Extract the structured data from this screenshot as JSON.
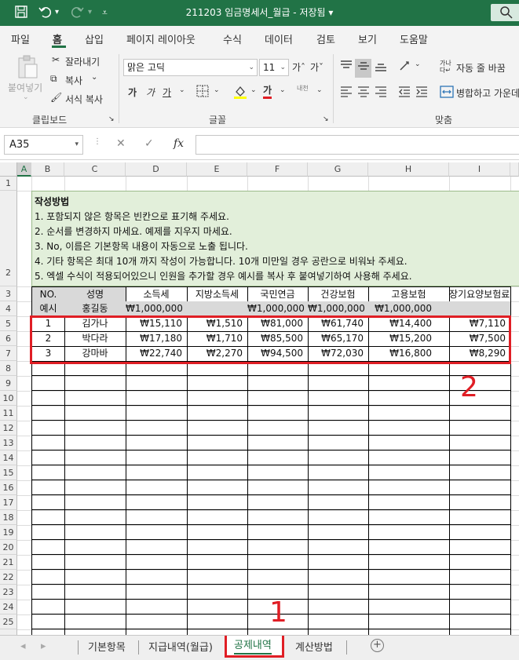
{
  "titlebar": {
    "title": "211203 임금명세서_월급  -  저장됨  ▾",
    "save_icon": "save-icon",
    "undo_icon": "undo-icon",
    "redo_icon": "redo-icon",
    "customize_icon": "customize-qat-icon"
  },
  "ribbon_tabs": [
    "파일",
    "홈",
    "삽입",
    "페이지 레이아웃",
    "수식",
    "데이터",
    "검토",
    "보기",
    "도움말"
  ],
  "clipboard": {
    "paste": "붙여넣기",
    "cut": "잘라내기",
    "copy": "복사",
    "format_painter": "서식 복사",
    "group": "클립보드"
  },
  "font": {
    "name": "맑은 고딕",
    "size": "11",
    "grow": "가ˆ",
    "shrink": "가ˇ",
    "bold": "가",
    "italic": "가",
    "underline": "가",
    "font_color": "가",
    "phonetic": "내천",
    "group": "글꼴"
  },
  "alignment": {
    "wrap_text": "자동 줄 바꿈",
    "merge": "병합하고 가운데",
    "group": "맞춤"
  },
  "formula_bar": {
    "name_box": "A35",
    "fx": "fx",
    "formula": ""
  },
  "columns": [
    "A",
    "B",
    "C",
    "D",
    "E",
    "F",
    "G",
    "H",
    "I"
  ],
  "rows": [
    "1",
    "2",
    "3",
    "4",
    "5",
    "6",
    "7",
    "8",
    "9",
    "10",
    "11",
    "12",
    "13",
    "14",
    "15",
    "16",
    "17",
    "18",
    "19",
    "20",
    "21",
    "22",
    "23",
    "24",
    "25"
  ],
  "instructions": [
    "작성방법",
    "1. 포함되지 않은 항목은 빈칸으로 표기해 주세요.",
    "2. 순서를 변경하지 마세요. 예제를 지우지 마세요.",
    "3. No, 이름은 기본항목 내용이 자동으로 노출 됩니다.",
    "4. 기타 항목은 최대 10개 까지 작성이 가능합니다. 10개 미만일 경우 공란으로 비워놔 주세요.",
    "5. 엑셀 수식이 적용되어있으니 인원을 추가할 경우 예시를 복사 후 붙여넣기하여 사용해 주세요."
  ],
  "table": {
    "headers": [
      "NO.",
      "성명",
      "소득세",
      "지방소득세",
      "국민연금",
      "건강보험",
      "고용보험",
      "장기요양보험료"
    ],
    "example": [
      "예시",
      "홍길동",
      "₩1,000,000",
      "",
      "₩1,000,000",
      "₩1,000,000",
      "₩1,000,000",
      ""
    ],
    "rows": [
      [
        "1",
        "김가나",
        "₩15,110",
        "₩1,510",
        "₩81,000",
        "₩61,740",
        "₩14,400",
        "₩7,110"
      ],
      [
        "2",
        "박다라",
        "₩17,180",
        "₩1,710",
        "₩85,500",
        "₩65,170",
        "₩15,200",
        "₩7,500"
      ],
      [
        "3",
        "강마바",
        "₩22,740",
        "₩2,270",
        "₩94,500",
        "₩72,030",
        "₩16,800",
        "₩8,290"
      ]
    ]
  },
  "annotations": {
    "label1": "1",
    "label2": "2"
  },
  "sheet_tabs": [
    "기본항목",
    "지급내역(월급)",
    "공제내역",
    "계산방법"
  ],
  "active_sheet": "공제내역",
  "accent_color": "#217346",
  "highlight_color": "#e01e25"
}
